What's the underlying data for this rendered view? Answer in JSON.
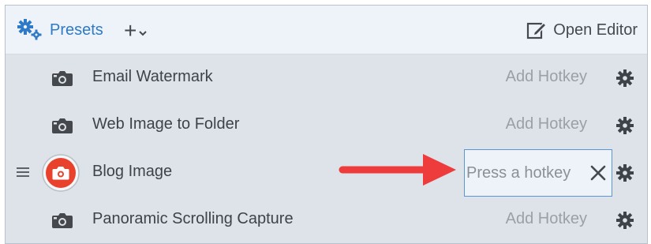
{
  "header": {
    "presets_label": "Presets",
    "add_label": "+",
    "open_editor_label": "Open Editor",
    "icons": {
      "presets": "gear-cluster-icon",
      "add_dropdown": "chevron-down-icon",
      "open_editor": "edit-pencil-icon"
    }
  },
  "presets": [
    {
      "name": "Email Watermark",
      "hotkey": "Add Hotkey",
      "icon": "camera-icon"
    },
    {
      "name": "Web Image to Folder",
      "hotkey": "Add Hotkey",
      "icon": "camera-icon"
    },
    {
      "name": "Blog Image",
      "hotkey_placeholder": "Press a hotkey",
      "icon": "record-camera-icon",
      "selected": true
    },
    {
      "name": "Panoramic Scrolling Capture",
      "hotkey": "Add Hotkey",
      "icon": "camera-icon"
    }
  ],
  "colors": {
    "accent": "#2f7ac6",
    "record_red": "#e8412c",
    "arrow_red": "#ee3b3b",
    "panel_bg": "#dde3e9",
    "header_bg": "#eef3f9",
    "input_border": "#5a96d6"
  }
}
